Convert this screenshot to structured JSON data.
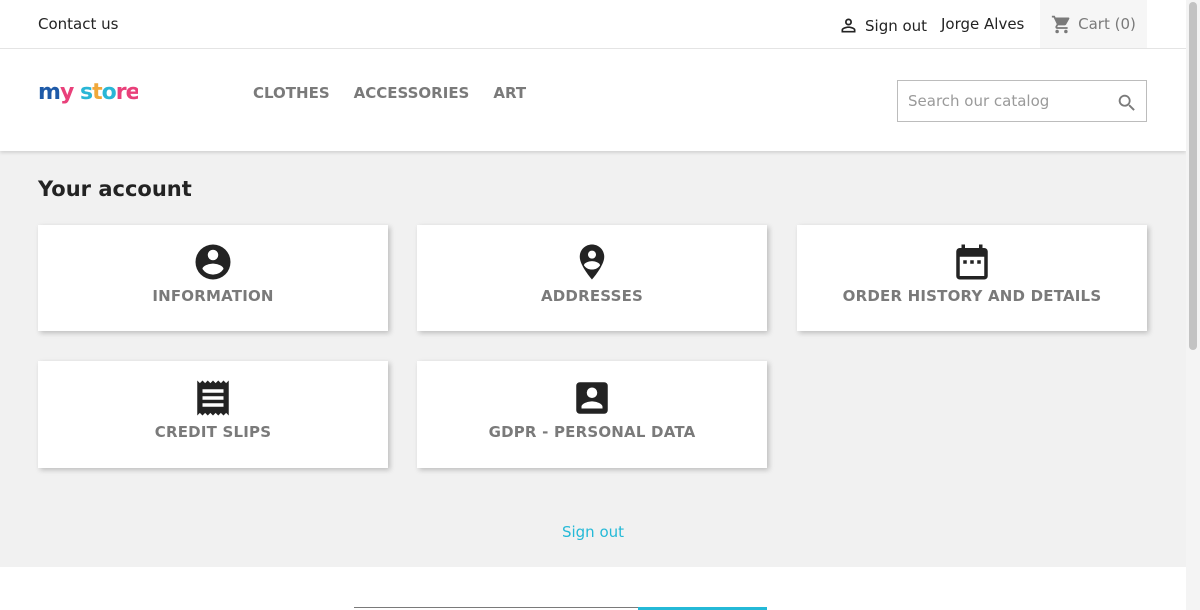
{
  "topnav": {
    "contact_label": "Contact us",
    "signout_label": "Sign out",
    "user_name": "Jorge Alves",
    "cart_label": "Cart",
    "cart_count": "(0)"
  },
  "header": {
    "logo_text": "my store",
    "menu": [
      "CLOTHES",
      "ACCESSORIES",
      "ART"
    ],
    "search_placeholder": "Search our catalog"
  },
  "main": {
    "title": "Your account",
    "links": [
      {
        "label": "INFORMATION",
        "icon": "account-circle-icon"
      },
      {
        "label": "ADDRESSES",
        "icon": "location-pin-icon"
      },
      {
        "label": "ORDER HISTORY AND DETAILS",
        "icon": "calendar-icon"
      },
      {
        "label": "CREDIT SLIPS",
        "icon": "receipt-icon"
      },
      {
        "label": "GDPR - PERSONAL DATA",
        "icon": "account-box-icon"
      }
    ],
    "signout_label": "Sign out"
  },
  "colors": {
    "accent": "#24b9d7",
    "main_bg": "#f1f1f1",
    "muted_text": "#7a7a7a"
  }
}
